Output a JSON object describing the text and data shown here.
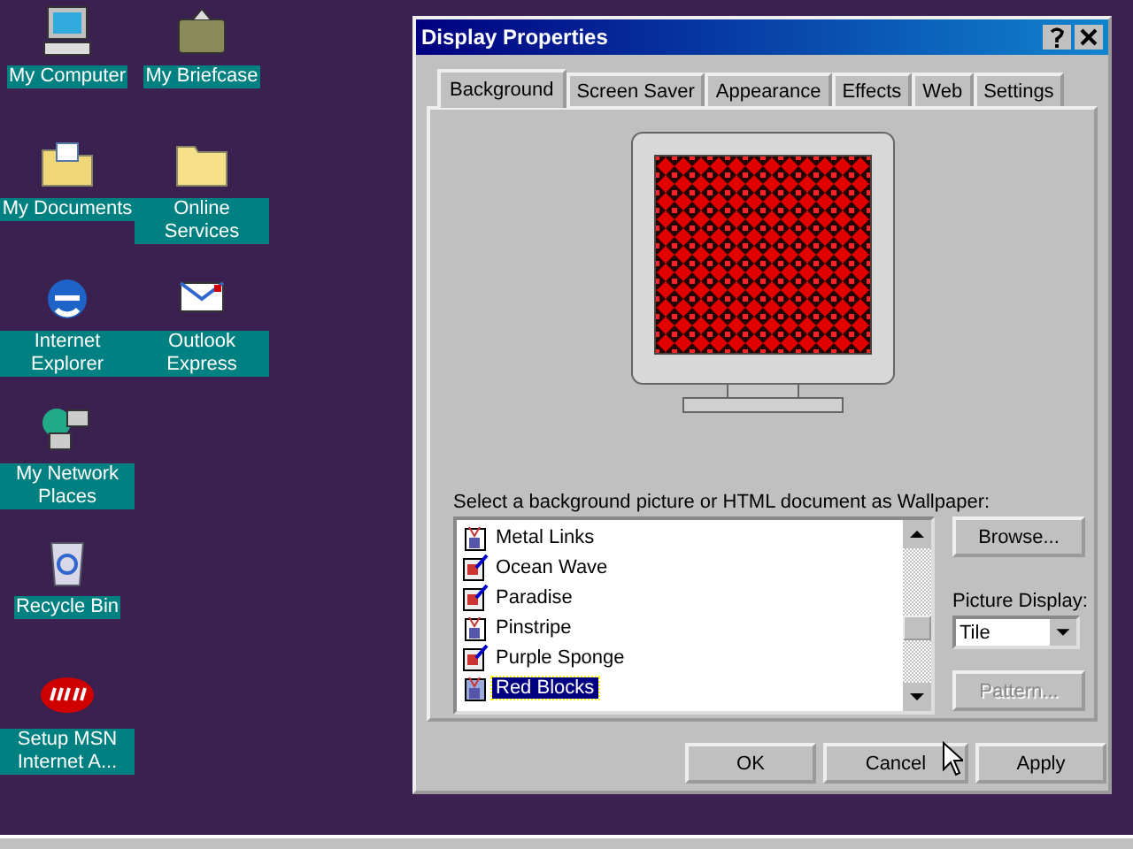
{
  "desktop_icons": [
    {
      "label": "My Computer",
      "kind": "computer"
    },
    {
      "label": "My Briefcase",
      "kind": "briefcase"
    },
    {
      "label": "My Documents",
      "kind": "documents"
    },
    {
      "label": "Online Services",
      "kind": "folder"
    },
    {
      "label": "Internet Explorer",
      "kind": "browser"
    },
    {
      "label": "Outlook Express",
      "kind": "mail"
    },
    {
      "label": "My Network Places",
      "kind": "network"
    },
    {
      "label": "Recycle Bin",
      "kind": "bin"
    },
    {
      "label": "Setup MSN Internet A...",
      "kind": "msn"
    }
  ],
  "window": {
    "title": "Display Properties"
  },
  "tabs": [
    {
      "label": "Background",
      "selected": true
    },
    {
      "label": "Screen Saver",
      "selected": false
    },
    {
      "label": "Appearance",
      "selected": false
    },
    {
      "label": "Effects",
      "selected": false
    },
    {
      "label": "Web",
      "selected": false
    },
    {
      "label": "Settings",
      "selected": false
    }
  ],
  "wallpaper_label": "Select a background picture or HTML document as Wallpaper:",
  "wallpapers": [
    {
      "name": "Metal Links",
      "kind": "html",
      "selected": false
    },
    {
      "name": "Ocean Wave",
      "kind": "bitmap",
      "selected": false
    },
    {
      "name": "Paradise",
      "kind": "bitmap",
      "selected": false
    },
    {
      "name": "Pinstripe",
      "kind": "html",
      "selected": false
    },
    {
      "name": "Purple Sponge",
      "kind": "bitmap",
      "selected": false
    },
    {
      "name": "Red Blocks",
      "kind": "html",
      "selected": true
    }
  ],
  "browse_button": {
    "label": "Browse...",
    "disabled": false
  },
  "picture_display": {
    "label": "Picture Display:",
    "value": "Tile"
  },
  "pattern_button": {
    "label": "Pattern...",
    "disabled": true
  },
  "buttons": [
    "OK",
    "Cancel",
    "Apply"
  ]
}
